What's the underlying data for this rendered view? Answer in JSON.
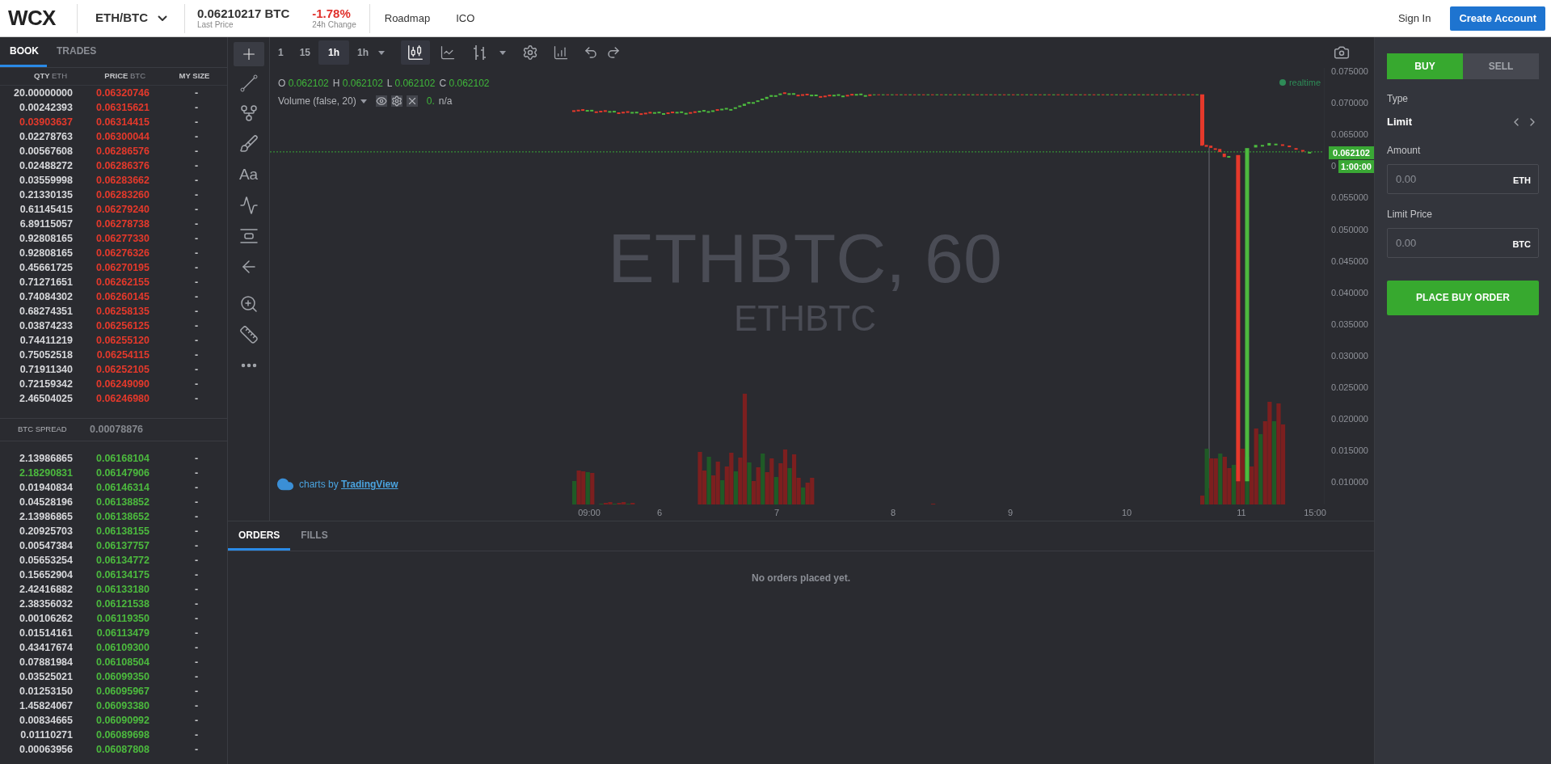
{
  "header": {
    "logo": "WCX",
    "pair": "ETH/BTC",
    "last_price": "0.06210217 BTC",
    "last_price_label": "Last Price",
    "change": "-1.78%",
    "change_label": "24h Change",
    "nav": [
      "Roadmap",
      "ICO"
    ],
    "sign_in": "Sign In",
    "create_account": "Create Account"
  },
  "book": {
    "tabs": [
      {
        "label": "BOOK",
        "selected": true
      },
      {
        "label": "TRADES",
        "selected": false
      }
    ],
    "columns": [
      {
        "label": "QTY",
        "unit": "ETH"
      },
      {
        "label": "PRICE",
        "unit": "BTC"
      },
      {
        "label": "MY SIZE"
      }
    ],
    "asks": [
      {
        "qty": "20.00000000",
        "price": "0.06320746",
        "my_size": "-",
        "highlight": false
      },
      {
        "qty": "0.00242393",
        "price": "0.06315621",
        "my_size": "-",
        "highlight": false
      },
      {
        "qty": "0.03903637",
        "price": "0.06314415",
        "my_size": "-",
        "highlight": true
      },
      {
        "qty": "0.02278763",
        "price": "0.06300044",
        "my_size": "-",
        "highlight": false
      },
      {
        "qty": "0.00567608",
        "price": "0.06286576",
        "my_size": "-",
        "highlight": false
      },
      {
        "qty": "0.02488272",
        "price": "0.06286376",
        "my_size": "-",
        "highlight": false
      },
      {
        "qty": "0.03559998",
        "price": "0.06283662",
        "my_size": "-",
        "highlight": false
      },
      {
        "qty": "0.21330135",
        "price": "0.06283260",
        "my_size": "-",
        "highlight": false
      },
      {
        "qty": "0.61145415",
        "price": "0.06279240",
        "my_size": "-",
        "highlight": false
      },
      {
        "qty": "6.89115057",
        "price": "0.06278738",
        "my_size": "-",
        "highlight": false
      },
      {
        "qty": "0.92808165",
        "price": "0.06277330",
        "my_size": "-",
        "highlight": false
      },
      {
        "qty": "0.92808165",
        "price": "0.06276326",
        "my_size": "-",
        "highlight": false
      },
      {
        "qty": "0.45661725",
        "price": "0.06270195",
        "my_size": "-",
        "highlight": false
      },
      {
        "qty": "0.71271651",
        "price": "0.06262155",
        "my_size": "-",
        "highlight": false
      },
      {
        "qty": "0.74084302",
        "price": "0.06260145",
        "my_size": "-",
        "highlight": false
      },
      {
        "qty": "0.68274351",
        "price": "0.06258135",
        "my_size": "-",
        "highlight": false
      },
      {
        "qty": "0.03874233",
        "price": "0.06256125",
        "my_size": "-",
        "highlight": false
      },
      {
        "qty": "0.74411219",
        "price": "0.06255120",
        "my_size": "-",
        "highlight": false
      },
      {
        "qty": "0.75052518",
        "price": "0.06254115",
        "my_size": "-",
        "highlight": false
      },
      {
        "qty": "0.71911340",
        "price": "0.06252105",
        "my_size": "-",
        "highlight": false
      },
      {
        "qty": "0.72159342",
        "price": "0.06249090",
        "my_size": "-",
        "highlight": false
      },
      {
        "qty": "2.46504025",
        "price": "0.06246980",
        "my_size": "-",
        "highlight": false
      }
    ],
    "spread": {
      "label": "BTC SPREAD",
      "value": "0.00078876"
    },
    "bids": [
      {
        "qty": "2.13986865",
        "price": "0.06168104",
        "my_size": "-",
        "highlight": false
      },
      {
        "qty": "2.18290831",
        "price": "0.06147906",
        "my_size": "-",
        "highlight": true
      },
      {
        "qty": "0.01940834",
        "price": "0.06146314",
        "my_size": "-",
        "highlight": false
      },
      {
        "qty": "0.04528196",
        "price": "0.06138852",
        "my_size": "-",
        "highlight": false
      },
      {
        "qty": "2.13986865",
        "price": "0.06138652",
        "my_size": "-",
        "highlight": false
      },
      {
        "qty": "0.20925703",
        "price": "0.06138155",
        "my_size": "-",
        "highlight": false
      },
      {
        "qty": "0.00547384",
        "price": "0.06137757",
        "my_size": "-",
        "highlight": false
      },
      {
        "qty": "0.05653254",
        "price": "0.06134772",
        "my_size": "-",
        "highlight": false
      },
      {
        "qty": "0.15652904",
        "price": "0.06134175",
        "my_size": "-",
        "highlight": false
      },
      {
        "qty": "2.42416882",
        "price": "0.06133180",
        "my_size": "-",
        "highlight": false
      },
      {
        "qty": "2.38356032",
        "price": "0.06121538",
        "my_size": "-",
        "highlight": false
      },
      {
        "qty": "0.00106262",
        "price": "0.06119350",
        "my_size": "-",
        "highlight": false
      },
      {
        "qty": "0.01514161",
        "price": "0.06113479",
        "my_size": "-",
        "highlight": false
      },
      {
        "qty": "0.43417674",
        "price": "0.06109300",
        "my_size": "-",
        "highlight": false
      },
      {
        "qty": "0.07881984",
        "price": "0.06108504",
        "my_size": "-",
        "highlight": false
      },
      {
        "qty": "0.03525021",
        "price": "0.06099350",
        "my_size": "-",
        "highlight": false
      },
      {
        "qty": "0.01253150",
        "price": "0.06095967",
        "my_size": "-",
        "highlight": false
      },
      {
        "qty": "1.45824067",
        "price": "0.06093380",
        "my_size": "-",
        "highlight": false
      },
      {
        "qty": "0.00834665",
        "price": "0.06090992",
        "my_size": "-",
        "highlight": false
      },
      {
        "qty": "0.01110271",
        "price": "0.06089698",
        "my_size": "-",
        "highlight": false
      },
      {
        "qty": "0.00063956",
        "price": "0.06087808",
        "my_size": "-",
        "highlight": false
      }
    ]
  },
  "chart": {
    "intervals": [
      {
        "label": "1",
        "selected": false
      },
      {
        "label": "15",
        "selected": false
      },
      {
        "label": "1h",
        "selected": true
      }
    ],
    "interval_dropdown": "1h",
    "ohlc": [
      {
        "label": "O",
        "value": "0.062102"
      },
      {
        "label": "H",
        "value": "0.062102"
      },
      {
        "label": "L",
        "value": "0.062102"
      },
      {
        "label": "C",
        "value": "0.062102"
      }
    ],
    "volume_study": "Volume (false, 20)",
    "volume_value": "0.",
    "volume_na": "n/a",
    "watermark": "ETHBTC, 60",
    "watermark_sub": "ETHBTC",
    "status": "realtime",
    "text_tool": "Aa",
    "price_axis": [
      "0.075000",
      "0.070000",
      "0.065000",
      "0",
      "0.055000",
      "0.050000",
      "0.045000",
      "0.040000",
      "0.035000",
      "0.030000",
      "0.025000",
      "0.020000",
      "0.015000",
      "0.010000"
    ],
    "last_price_tag": "0.062102",
    "countdown_tag": "1:00:00",
    "time_axis": [
      "09:00",
      "6",
      "7",
      "8",
      "9",
      "10",
      "11",
      "15:00"
    ],
    "credit": {
      "prefix": "charts by",
      "link": "TradingView"
    }
  },
  "orders": {
    "tabs": [
      {
        "label": "ORDERS",
        "selected": true
      },
      {
        "label": "FILLS",
        "selected": false
      }
    ],
    "empty": "No orders placed yet."
  },
  "trade": {
    "sides": [
      {
        "label": "BUY",
        "selected": true
      },
      {
        "label": "SELL",
        "selected": false
      }
    ],
    "type_label": "Type",
    "type_value": "Limit",
    "fields": [
      {
        "label": "Amount",
        "placeholder": "0.00",
        "unit": "ETH"
      },
      {
        "label": "Limit Price",
        "placeholder": "0.00",
        "unit": "BTC"
      }
    ],
    "submit": "PLACE BUY ORDER"
  }
}
